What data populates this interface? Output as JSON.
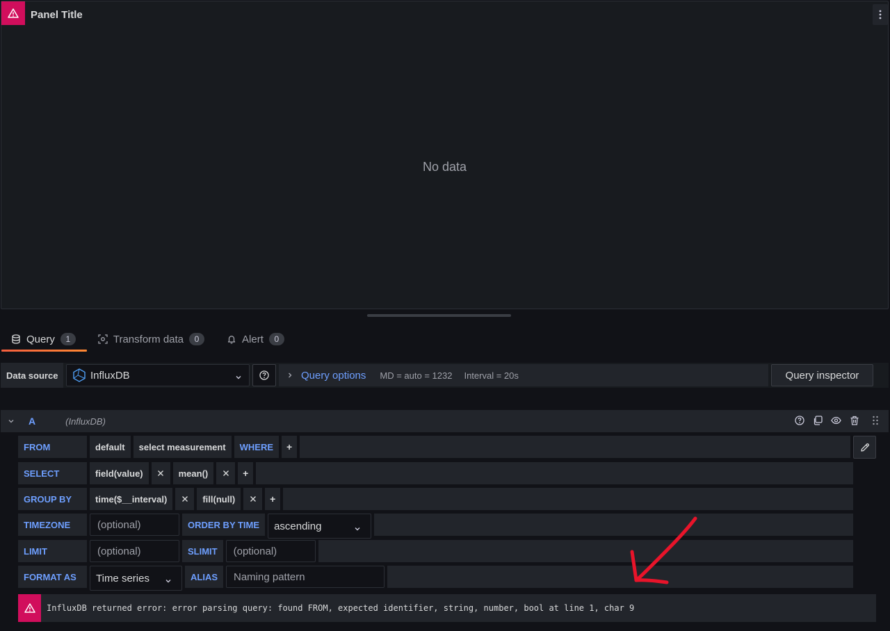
{
  "panel": {
    "title": "Panel Title",
    "no_data": "No data"
  },
  "tabs": [
    {
      "label": "Query",
      "count": "1",
      "icon": "database-icon",
      "active": true
    },
    {
      "label": "Transform data",
      "count": "0",
      "icon": "transform-icon",
      "active": false
    },
    {
      "label": "Alert",
      "count": "0",
      "icon": "bell-icon",
      "active": false
    }
  ],
  "header": {
    "datasource_label": "Data source",
    "datasource_value": "InfluxDB",
    "query_options_label": "Query options",
    "md": "MD = auto = 1232",
    "interval": "Interval = 20s",
    "query_inspector": "Query inspector"
  },
  "query": {
    "ref_id": "A",
    "datasource": "(InfluxDB)",
    "from": {
      "keyword": "FROM",
      "policy": "default",
      "measurement": "select measurement",
      "where": "WHERE",
      "plus": "+"
    },
    "select": {
      "keyword": "SELECT",
      "field": "field(value)",
      "agg": "mean()",
      "plus": "+"
    },
    "group_by": {
      "keyword": "GROUP BY",
      "time": "time($__interval)",
      "fill": "fill(null)",
      "plus": "+"
    },
    "timezone": {
      "keyword": "TIMEZONE",
      "placeholder": "(optional)",
      "order_keyword": "ORDER BY TIME",
      "order_value": "ascending"
    },
    "limit": {
      "keyword": "LIMIT",
      "placeholder": "(optional)",
      "slimit_keyword": "SLIMIT",
      "slimit_placeholder": "(optional)"
    },
    "format_as": {
      "keyword": "FORMAT AS",
      "value": "Time series",
      "alias_keyword": "ALIAS",
      "alias_placeholder": "Naming pattern"
    }
  },
  "error": {
    "message": "InfluxDB returned error: error parsing query: found FROM, expected identifier, string, number, bool at line 1, char 9"
  },
  "colors": {
    "error": "#d10e5c",
    "keyword": "#6e9fff",
    "tab_underline": "#f55f3e",
    "annotation": "#e8142a"
  }
}
